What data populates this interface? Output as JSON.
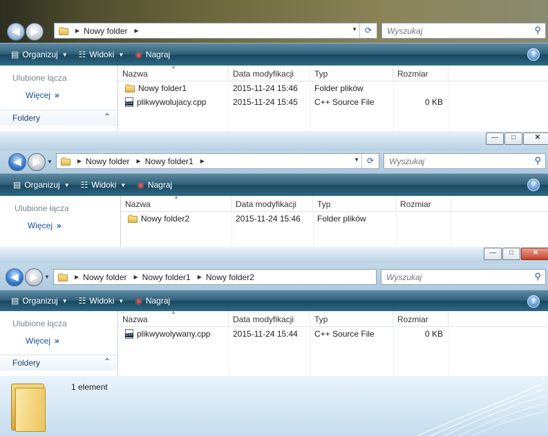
{
  "window1": {
    "breadcrumb": [
      "Nowy folder"
    ],
    "search_placeholder": "Wyszukaj",
    "toolbar": {
      "organize": "Organizuj",
      "views": "Widoki",
      "burn": "Nagraj"
    },
    "nav": {
      "favorites": "Ulubione łącza",
      "more": "Więcej",
      "folders": "Foldery"
    },
    "columns": [
      "Nazwa",
      "Data modyfikacji",
      "Typ",
      "Rozmiar"
    ],
    "rows": [
      {
        "name": "Nowy folder1",
        "date": "2015-11-24 15:46",
        "type": "Folder plików",
        "size": "",
        "icon": "folder-icon"
      },
      {
        "name": "plikwywolujacy.cpp",
        "date": "2015-11-24 15:45",
        "type": "C++ Source File",
        "size": "0 KB",
        "icon": "cpp-file-icon"
      }
    ]
  },
  "window2": {
    "breadcrumb": [
      "Nowy folder",
      "Nowy folder1"
    ],
    "search_placeholder": "Wyszukaj",
    "toolbar": {
      "organize": "Organizuj",
      "views": "Widoki",
      "burn": "Nagraj"
    },
    "nav": {
      "favorites": "Ulubione łącza",
      "more": "Więcej"
    },
    "columns": [
      "Nazwa",
      "Data modyfikacji",
      "Typ",
      "Rozmiar"
    ],
    "rows": [
      {
        "name": "Nowy folder2",
        "date": "2015-11-24 15:46",
        "type": "Folder plików",
        "size": "",
        "icon": "folder-icon"
      }
    ]
  },
  "window3": {
    "breadcrumb": [
      "Nowy folder",
      "Nowy folder1",
      "Nowy folder2"
    ],
    "search_placeholder": "Wyszukaj",
    "toolbar": {
      "organize": "Organizuj",
      "views": "Widoki",
      "burn": "Nagraj"
    },
    "nav": {
      "favorites": "Ulubione łącza",
      "more": "Więcej",
      "folders": "Foldery"
    },
    "columns": [
      "Nazwa",
      "Data modyfikacji",
      "Typ",
      "Rozmiar"
    ],
    "rows": [
      {
        "name": "plikwywolywany.cpp",
        "date": "2015-11-24 15:44",
        "type": "C++ Source File",
        "size": "0 KB",
        "icon": "cpp-file-icon"
      }
    ],
    "details": {
      "count": "1 element"
    }
  },
  "colors": {
    "toolbar": "#194860",
    "link": "#1b4f9c",
    "close_red": "#c9442c"
  }
}
